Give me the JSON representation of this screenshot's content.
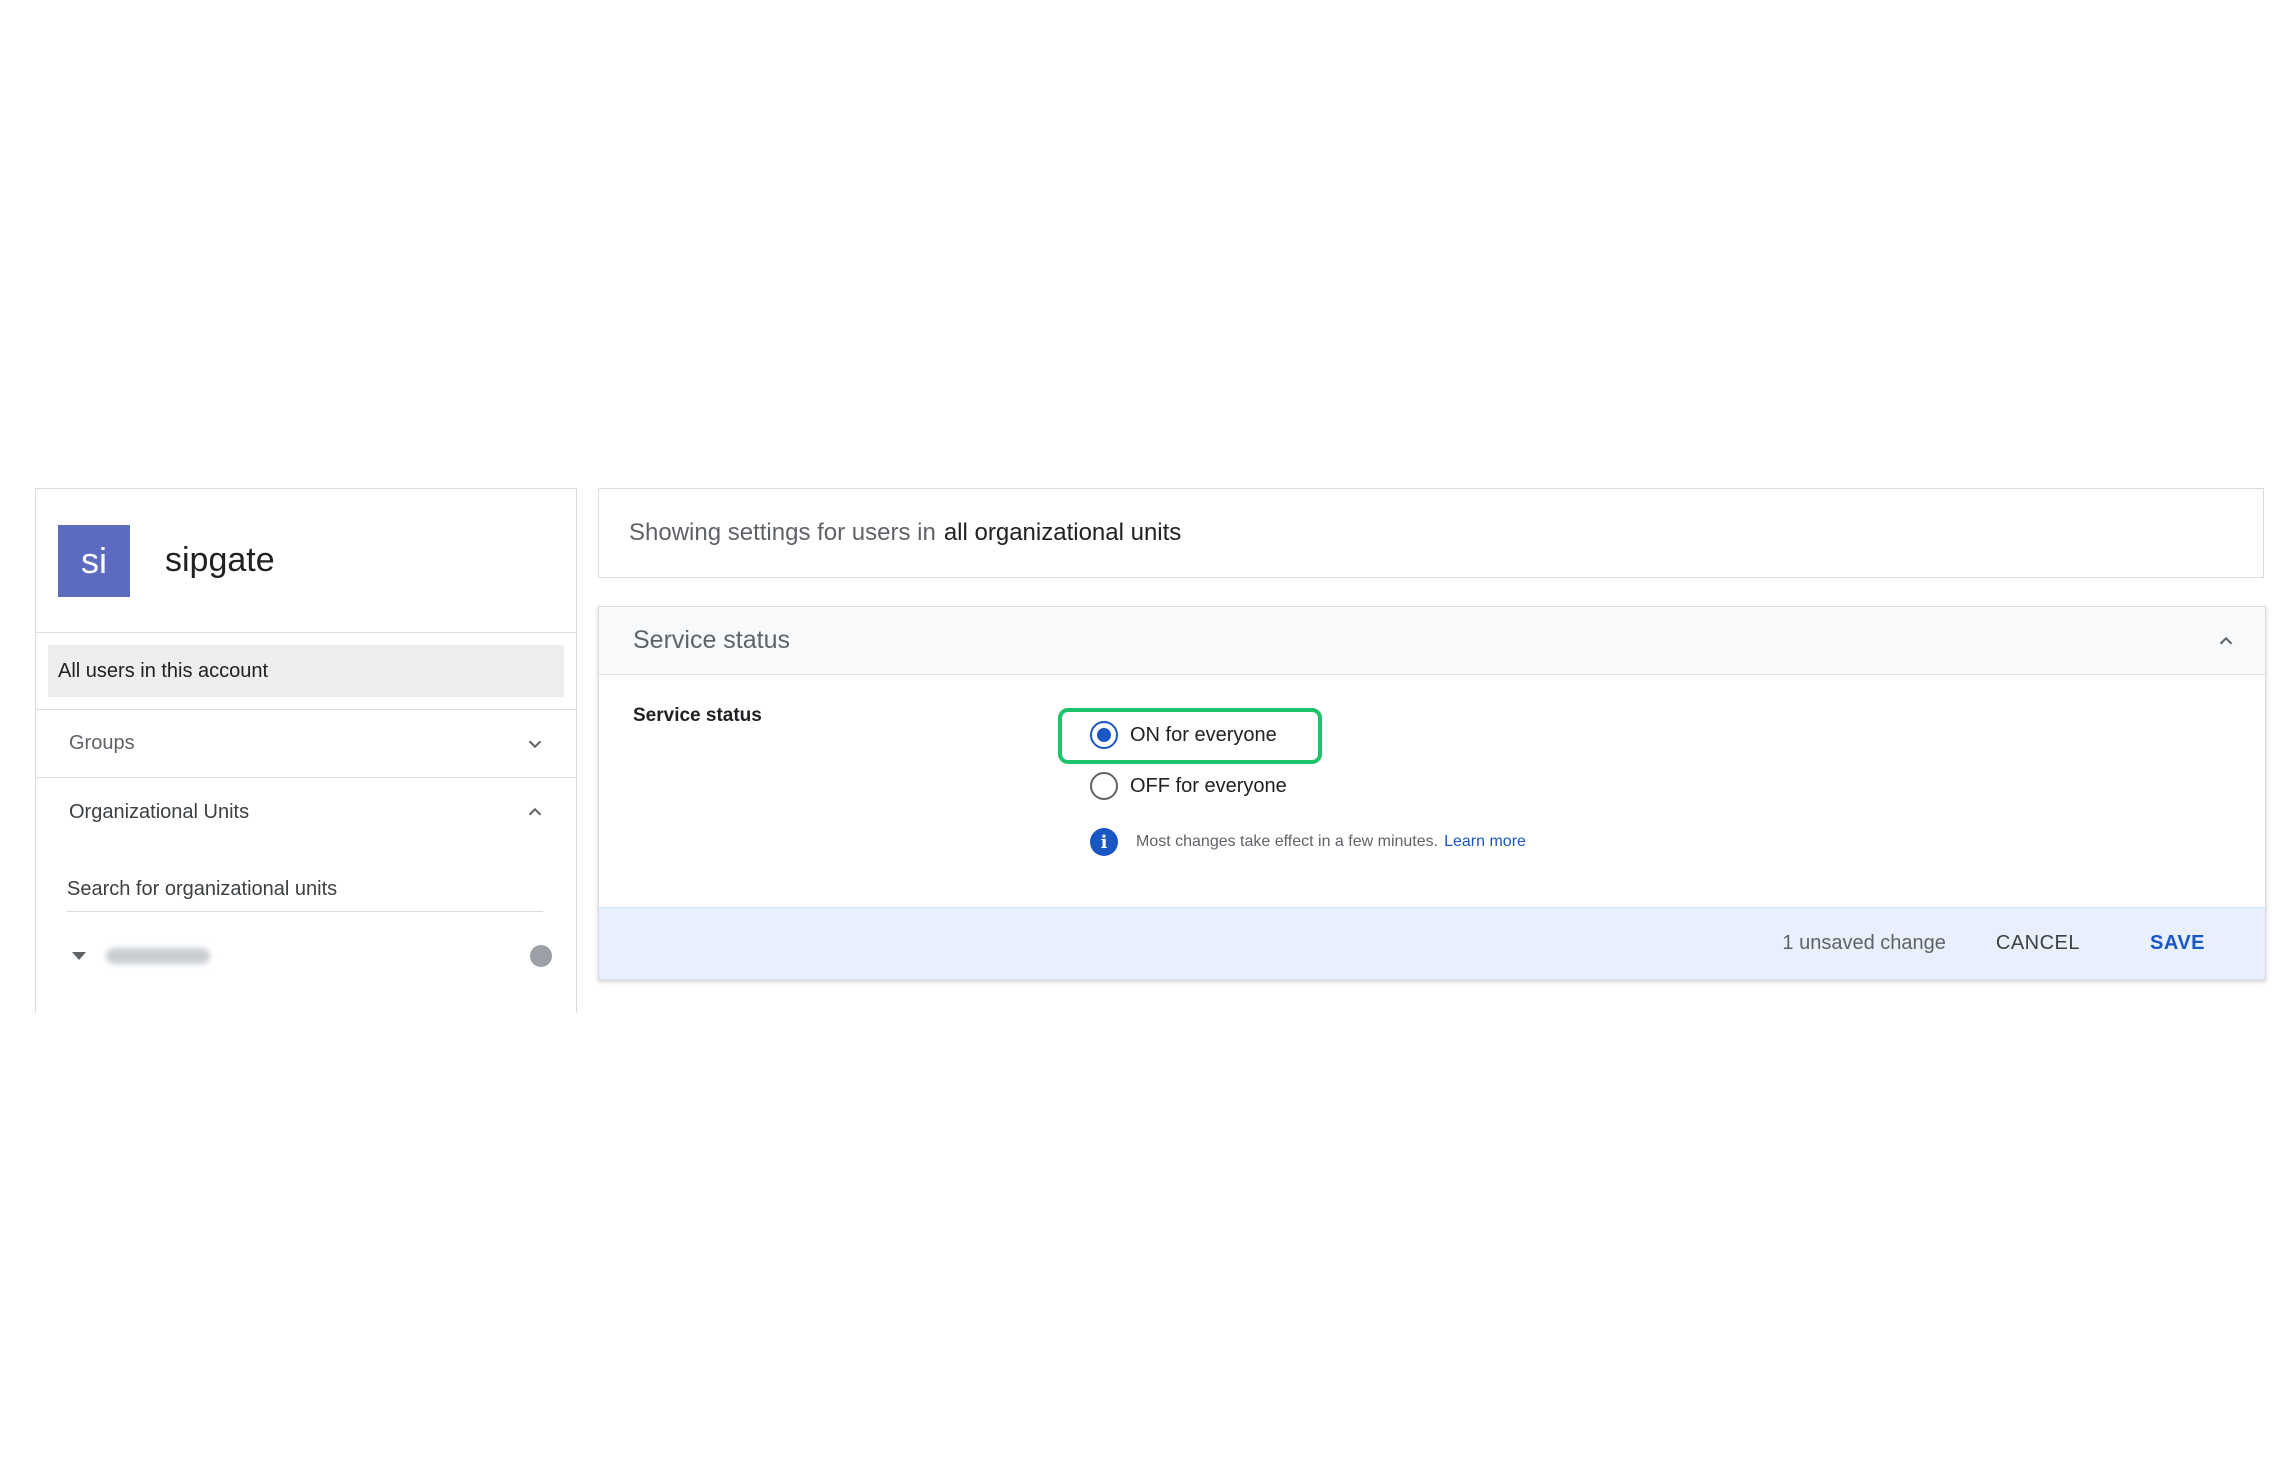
{
  "account": {
    "avatar_initials": "si",
    "name": "sipgate"
  },
  "sidebar": {
    "all_users_label": "All users in this account",
    "groups_label": "Groups",
    "ou_label": "Organizational Units",
    "ou_search_placeholder": "Search for organizational units"
  },
  "info_bar": {
    "prefix": "Showing settings for users in",
    "scope": "all organizational units"
  },
  "card": {
    "title": "Service status",
    "field_label": "Service status",
    "options": [
      {
        "label": "ON for everyone",
        "selected": true
      },
      {
        "label": "OFF for everyone",
        "selected": false
      }
    ],
    "note_text": "Most changes take effect in a few minutes.",
    "learn_more": "Learn more",
    "unsaved_text": "1 unsaved change",
    "cancel_label": "CANCEL",
    "save_label": "SAVE"
  },
  "colors": {
    "accent": "#1a56c4",
    "avatar": "#5c6bc0",
    "highlight": "#1ec26b",
    "footer_bg": "#e8f0fe"
  },
  "icons": {
    "groups_toggle": "chevron-down-icon",
    "ou_toggle": "chevron-up-icon",
    "card_toggle": "chevron-up-icon",
    "tree_caret": "caret-down-icon",
    "note": "info-icon"
  }
}
